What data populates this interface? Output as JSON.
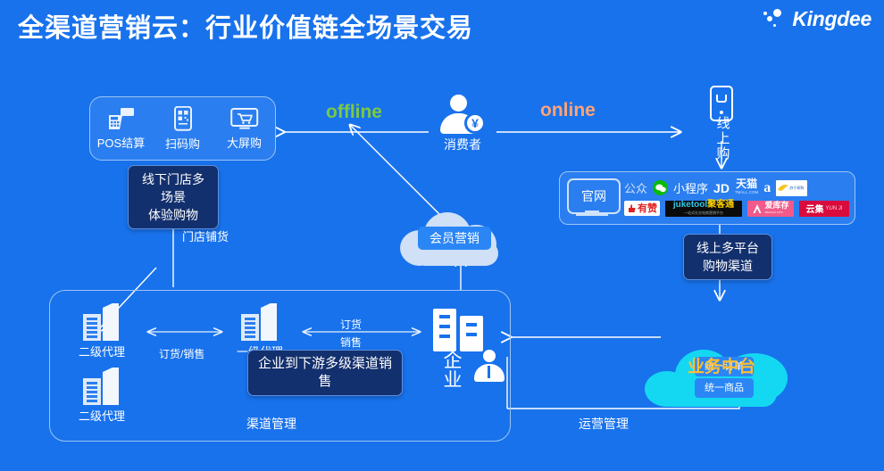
{
  "header": {
    "title": "全渠道营销云：行业价值链全场景交易",
    "brand": "Kingdee"
  },
  "colors": {
    "background": "#1872ec",
    "offline_green": "#7ac943",
    "online_orange": "#ffa378",
    "biz_label_yellow": "#ffbe2e",
    "cloud_light": "#cfe0f7",
    "cloud_cyan": "#14d8f2",
    "tooltip_navy": "#13306e",
    "panel_border": "#9cc4f5"
  },
  "offline": {
    "flow_label": "offline",
    "store_box": {
      "items": [
        {
          "label": "POS结算",
          "icon": "pos-terminal-icon"
        },
        {
          "label": "扫码购",
          "icon": "qr-scan-mobile-icon"
        },
        {
          "label": "大屏购",
          "icon": "big-screen-cart-icon"
        }
      ]
    },
    "tooltip": "线下门店多场景\n体验购物",
    "distribution_label": "门店铺货"
  },
  "consumer": {
    "label": "消费者",
    "icon": "consumer-person-yen-icon"
  },
  "online": {
    "flow_label": "online",
    "phone_label": "线上购",
    "phone_icon": "mobile-shopping-icon",
    "platform_box": {
      "website": "官网",
      "logos_row1": [
        {
          "name": "公众",
          "style": "text"
        },
        {
          "name": "微信",
          "style": "wechat"
        },
        {
          "name": "小程序",
          "style": "text"
        },
        {
          "name": "JD",
          "style": "text"
        },
        {
          "name": "天猫",
          "style": "tmall"
        },
        {
          "name": "amazon",
          "style": "amazon"
        },
        {
          "name": "苏宁易购",
          "style": "suning"
        }
      ],
      "logos_row2": [
        {
          "name": "有赞",
          "style": "youzan"
        },
        {
          "name": "juketool 聚客通",
          "style": "juketool"
        },
        {
          "name": "爱库存",
          "style": "aikucun"
        },
        {
          "name": "云集 YUN JI",
          "style": "yunji"
        }
      ]
    },
    "tooltip": "线上多平台\n购物渠道"
  },
  "member_cloud": {
    "tag": "会员营销"
  },
  "enterprise": {
    "panel_label": "渠道管理",
    "center": {
      "label": "企业",
      "icon": "enterprise-building-icon",
      "person_icon": "manager-person-icon"
    },
    "agents": [
      {
        "label": "二级代理",
        "position": "top-left"
      },
      {
        "label": "一级代理",
        "position": "top-middle"
      },
      {
        "label": "二级代理",
        "position": "bottom-left"
      }
    ],
    "link_labels": [
      "订货/销售",
      "订货",
      "销售"
    ],
    "tooltip": "企业到下游多级渠道销售"
  },
  "business_middle": {
    "label": "业务中台",
    "tags": [
      "统一订单",
      "统一商品"
    ],
    "ops_label": "运营管理"
  }
}
